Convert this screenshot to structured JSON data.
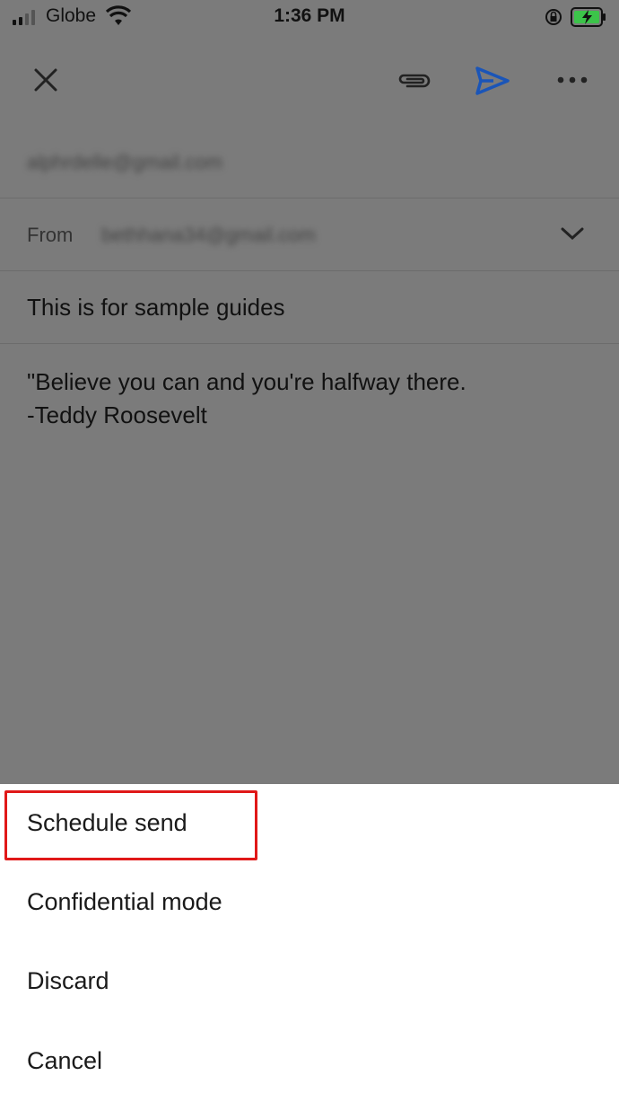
{
  "status_bar": {
    "carrier": "Globe",
    "time": "1:36 PM"
  },
  "compose": {
    "to_value": "alphrdelle@gmail.com",
    "from_label": "From",
    "from_value": "bethhana34@gmail.com",
    "subject": "This is for sample guides",
    "body_line1": "\"Believe you can and you're halfway there.",
    "body_line2": "-Teddy Roosevelt"
  },
  "menu": {
    "items": [
      {
        "label": "Schedule send"
      },
      {
        "label": "Confidential mode"
      },
      {
        "label": "Discard"
      },
      {
        "label": "Cancel"
      }
    ]
  },
  "colors": {
    "scrim": "#7b7b7b",
    "send_accent": "#1a55b8",
    "highlight": "#e01818"
  }
}
